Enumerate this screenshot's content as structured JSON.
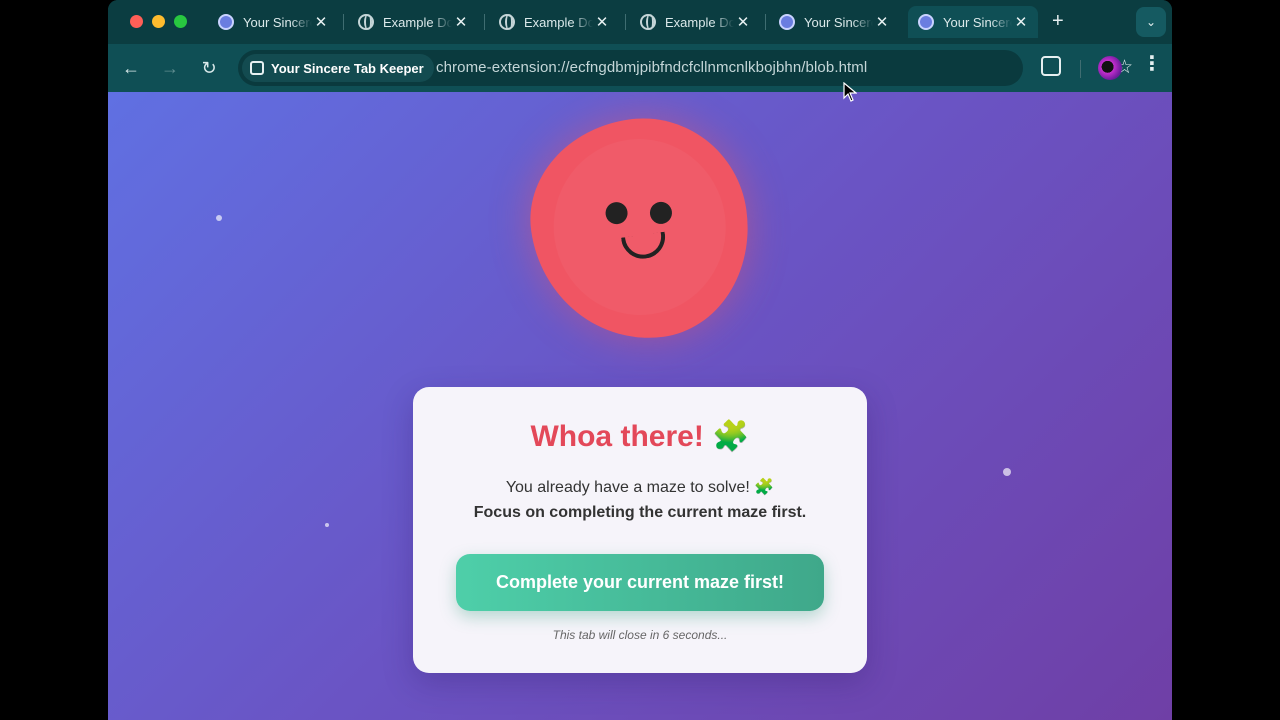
{
  "tabs": [
    {
      "title": "Your Sincere Tab Keeper",
      "favicon": "extension-icon",
      "active": false
    },
    {
      "title": "Example Domain",
      "favicon": "globe-icon",
      "active": false
    },
    {
      "title": "Example Domain",
      "favicon": "globe-icon",
      "active": false
    },
    {
      "title": "Example Domain",
      "favicon": "globe-icon",
      "active": false
    },
    {
      "title": "Your Sincere Tab Keeper",
      "favicon": "extension-icon",
      "active": false
    },
    {
      "title": "Your Sincere Tab Keeper",
      "favicon": "extension-icon",
      "active": true
    }
  ],
  "tab_close_glyph": "✕",
  "new_tab_glyph": "+",
  "tab_menu_glyph": "⌄",
  "toolbar": {
    "back_glyph": "←",
    "forward_glyph": "→",
    "reload_glyph": "↻",
    "site_chip_label": "Your Sincere Tab Keeper",
    "url": "chrome-extension://ecfngdbmjpibfndcfcllnmcnlkbojbhn/blob.html",
    "star_glyph": "☆",
    "menu_glyph": "⋮"
  },
  "card": {
    "title": "Whoa there!",
    "title_emoji": "🧩",
    "message_line1": "You already have a maze to solve! 🧩",
    "message_line2": "Focus on completing the current maze first.",
    "button_label": "Complete your current maze first!",
    "countdown_note": "This tab will close in 6 seconds..."
  },
  "colors": {
    "tab_strip": "#0b3d41",
    "toolbar": "#0f4f55",
    "page_gradient_start": "#6070e2",
    "page_gradient_end": "#6f3fa6",
    "blob": "#f05563",
    "title_red": "#e34859",
    "button_green": "#45bd9b"
  }
}
